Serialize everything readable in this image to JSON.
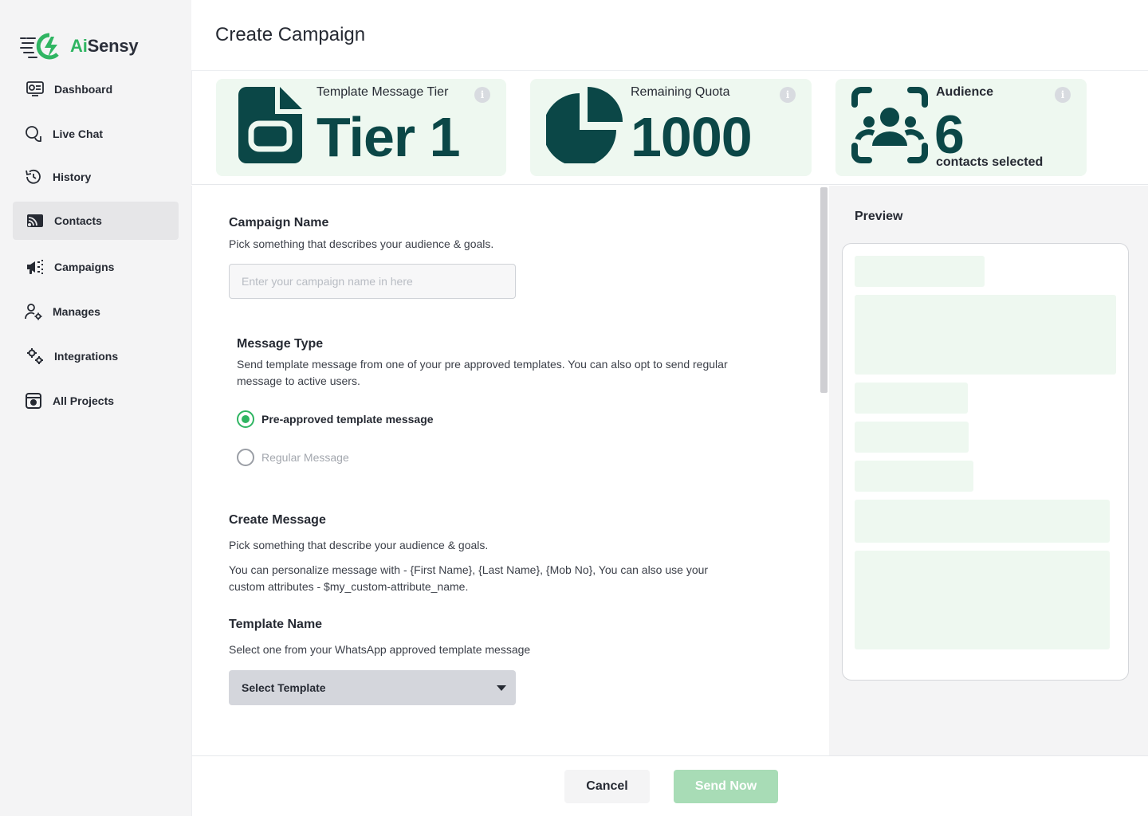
{
  "brand": {
    "name_part1": "Ai",
    "name_part2": "Sensy"
  },
  "sidebar": {
    "items": [
      {
        "label": "Dashboard",
        "icon": "dashboard-icon"
      },
      {
        "label": "Live Chat",
        "icon": "chat-icon"
      },
      {
        "label": "History",
        "icon": "history-icon"
      },
      {
        "label": "Contacts",
        "icon": "contacts-icon",
        "active": true
      },
      {
        "label": "Campaigns",
        "icon": "megaphone-icon"
      },
      {
        "label": "Manages",
        "icon": "user-gear-icon"
      },
      {
        "label": "Integrations",
        "icon": "gears-icon"
      },
      {
        "label": "All Projects",
        "icon": "projects-icon"
      }
    ]
  },
  "header": {
    "title": "Create Campaign"
  },
  "stats": {
    "tier": {
      "title": "Template Message Tier",
      "value": "Tier 1",
      "icon": "document-icon"
    },
    "quota": {
      "title": "Remaining Quota",
      "value": "1000",
      "icon": "pie-chart-icon"
    },
    "audience": {
      "title": "Audience",
      "value": "6",
      "sub": "contacts selected",
      "icon": "audience-icon"
    },
    "info_glyph": "i"
  },
  "form": {
    "campaign_name": {
      "title": "Campaign Name",
      "desc": "Pick something that describes your audience & goals.",
      "placeholder": "Enter your campaign name in here",
      "value": ""
    },
    "message_type": {
      "title": "Message Type",
      "desc": "Send template message from one of your pre approved templates. You can also opt to send regular message to active users.",
      "options": [
        {
          "label": "Pre-approved template message",
          "selected": true
        },
        {
          "label": "Regular Message",
          "selected": false
        }
      ]
    },
    "create_message": {
      "title": "Create Message",
      "desc1": "Pick something that describe your audience & goals.",
      "desc2": "You can personalize message with - {First Name}, {Last Name}, {Mob No}, You can also use your custom attributes - $my_custom-attribute_name."
    },
    "template_name": {
      "title": "Template Name",
      "desc": "Select one from your WhatsApp approved template message",
      "select_label": "Select Template"
    }
  },
  "preview": {
    "title": "Preview"
  },
  "footer": {
    "cancel_label": "Cancel",
    "send_label": "Send Now"
  },
  "colors": {
    "brand_green": "#2fb562",
    "dark_teal": "#0b4747",
    "card_bg": "#eef8f0",
    "send_disabled": "#a8dcb6"
  }
}
